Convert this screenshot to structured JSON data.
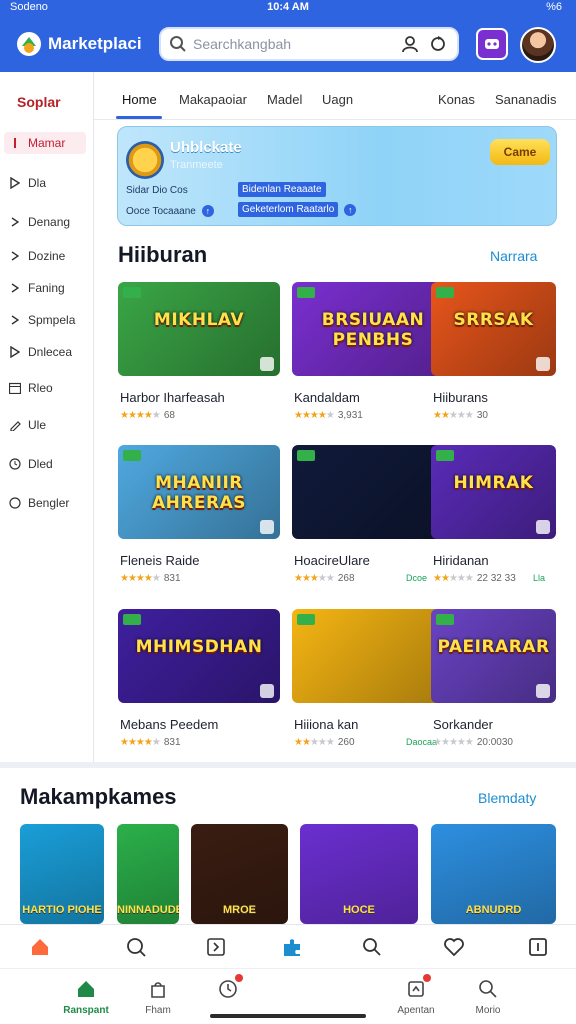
{
  "status": {
    "carrier": "Sodeno",
    "time": "10:4 AM",
    "battery": "%6"
  },
  "header": {
    "brand": "Marketplaci",
    "search_placeholder": "Searchkangbah"
  },
  "sidebar": {
    "title": "Soplar",
    "items": [
      {
        "label": "Mamar",
        "icon": "bar-icon",
        "active": true
      },
      {
        "label": "Dla",
        "icon": "play-icon"
      },
      {
        "label": "Denang",
        "icon": "chevron-right-icon"
      },
      {
        "label": "Dozine",
        "icon": "chevron-right-icon"
      },
      {
        "label": "Faning",
        "icon": "chevron-right-icon"
      },
      {
        "label": "Spmpela",
        "icon": "chevron-right-icon"
      },
      {
        "label": "Dnlecea",
        "icon": "play-icon"
      },
      {
        "label": "Rleo",
        "icon": "calendar-icon"
      },
      {
        "label": "Ule",
        "icon": "pencil-icon"
      },
      {
        "label": "Dled",
        "icon": "clock-icon"
      },
      {
        "label": "Bengler",
        "icon": "circle-icon"
      }
    ]
  },
  "tabs": [
    {
      "label": "Home",
      "active": true
    },
    {
      "label": "Makapaoiar"
    },
    {
      "label": "Madel"
    },
    {
      "label": "Uagn"
    },
    {
      "label": "Konas"
    },
    {
      "label": "Sananadis"
    }
  ],
  "banner": {
    "title": "Uhblckate",
    "subtitle": "Tranmeete",
    "button": "Came",
    "row1_left": "Sidar Dio Cos",
    "row1_right": "Bidenlan Reaaate",
    "row2_left": "Ooce Tocaaane",
    "row2_right": "Geketerlom Raatarlo"
  },
  "section1": {
    "title": "Hiiburan",
    "link": "Narrara",
    "cards": [
      {
        "name": "Harbor Iharfeasah",
        "art": "MIKHLAV",
        "rating": 3.5,
        "count": "68",
        "extra": "",
        "bg": "#3aa646"
      },
      {
        "name": "Kandaldam",
        "art": "BRSIUAAN PENBHS",
        "rating": 4,
        "count": "3,931",
        "extra": "",
        "bg": "#7a2fd0"
      },
      {
        "name": "Hiiburans",
        "art": "SRRSAK",
        "rating": 2,
        "count": "30",
        "extra": "",
        "bg": "#e8551b"
      },
      {
        "name": "Fleneis Raide",
        "art": "MHANIIR AHRERAS",
        "rating": 4,
        "count": "831",
        "extra": "",
        "bg": "#4fa9e0"
      },
      {
        "name": "HoacireUlare",
        "art": "",
        "rating": 3,
        "count": "268",
        "extra": "Dcoe",
        "bg": "#101a3a"
      },
      {
        "name": "Hiridanan",
        "art": "HIMRAK",
        "rating": 2,
        "count": "22 32 33",
        "extra": "Lla",
        "bg": "#5a2bb8"
      },
      {
        "name": "Mebans Peedem",
        "art": "MHIMSDHAN",
        "rating": 3.5,
        "count": "831",
        "extra": "",
        "bg": "#3f1f9e"
      },
      {
        "name": "Hiiiona kan",
        "art": "",
        "rating": 2,
        "count": "260",
        "extra": "Daocaa",
        "bg": "#f5b513"
      },
      {
        "name": "Sorkander",
        "art": "PAEIRARAR",
        "rating": 0,
        "count": "20:0030",
        "extra": "",
        "bg": "#6a43c4"
      }
    ]
  },
  "section2": {
    "title": "Makampkames",
    "link": "Blemdaty",
    "tiles": [
      {
        "label": "HARTIO PIOHE",
        "bg": "#1a9ed8"
      },
      {
        "label": "NINNADUDE",
        "bg": "#2bb04a"
      },
      {
        "label": "MROE",
        "bg": "#3a1d12"
      },
      {
        "label": "HOCE",
        "bg": "#6b2fd0"
      },
      {
        "label": "ABNUDRD",
        "bg": "#2d8fe0"
      }
    ]
  },
  "iconbar": [
    "home-icon",
    "search-refresh-icon",
    "puzzle-square-icon",
    "puzzle-icon",
    "search-icon",
    "heart-icon",
    "square-icon"
  ],
  "navbar": [
    {
      "label": "Ranspant",
      "icon": "home-icon",
      "active": true
    },
    {
      "label": "Fham",
      "icon": "bag-icon"
    },
    {
      "label": "",
      "icon": "clock-badge-icon"
    },
    {
      "label": "Apentan",
      "icon": "tablet-icon"
    },
    {
      "label": "Morio",
      "icon": "search-icon"
    }
  ]
}
